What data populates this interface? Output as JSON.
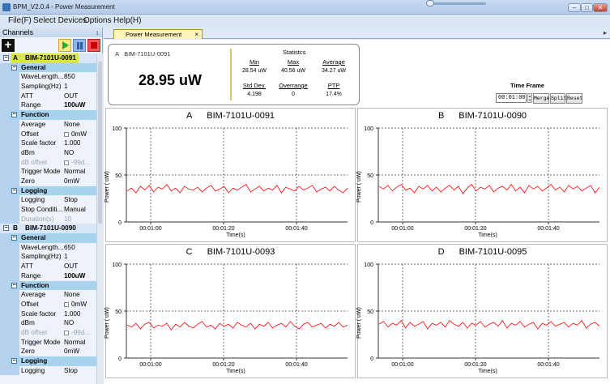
{
  "window": {
    "title": "BPM_V2.0.4 - Power Measurement",
    "minimize_glyph": "–",
    "restore_glyph": "□",
    "close_glyph": "✕"
  },
  "menu": {
    "items": [
      "File(F)",
      "Select Devices",
      "Options",
      "Help(H)"
    ]
  },
  "channels_panel": {
    "title": "Channels",
    "pin_glyph": "↕",
    "devices": [
      {
        "letter": "A",
        "name": "BIM-7101U-0091",
        "selected": true,
        "groups": [
          {
            "name": "General",
            "props": [
              {
                "key": "WaveLength...",
                "value": "850"
              },
              {
                "key": "Sampling(Hz)",
                "value": "1"
              },
              {
                "key": "ATT",
                "value": "OUT"
              },
              {
                "key": "Range",
                "value": "100uW",
                "bold": true
              }
            ]
          },
          {
            "name": "Function",
            "props": [
              {
                "key": "Average",
                "value": "None"
              },
              {
                "key": "Offset",
                "value": "0mW",
                "check": true
              },
              {
                "key": "Scale factor",
                "value": "1.000"
              },
              {
                "key": "dBm",
                "value": "NO"
              },
              {
                "key": "dB offset",
                "value": "-99d...",
                "check": true,
                "disabled": true
              },
              {
                "key": "Trigger Mode",
                "value": "Normal"
              },
              {
                "key": "Zero",
                "value": "0mW"
              }
            ]
          },
          {
            "name": "Logging",
            "props": [
              {
                "key": "Logging",
                "value": "Stop"
              },
              {
                "key": "Stop Conditi...",
                "value": "Manual"
              },
              {
                "key": "Duration(s)",
                "value": "10",
                "disabled": true
              }
            ]
          }
        ]
      },
      {
        "letter": "B",
        "name": "BIM-7101U-0090",
        "selected": false,
        "groups": [
          {
            "name": "General",
            "props": [
              {
                "key": "WaveLength...",
                "value": "650"
              },
              {
                "key": "Sampling(Hz)",
                "value": "1"
              },
              {
                "key": "ATT",
                "value": "OUT"
              },
              {
                "key": "Range",
                "value": "100uW",
                "bold": true
              }
            ]
          },
          {
            "name": "Function",
            "props": [
              {
                "key": "Average",
                "value": "None"
              },
              {
                "key": "Offset",
                "value": "0mW",
                "check": true
              },
              {
                "key": "Scale factor",
                "value": "1.000"
              },
              {
                "key": "dBm",
                "value": "NO"
              },
              {
                "key": "dB offset",
                "value": "-99d...",
                "check": true,
                "disabled": true
              },
              {
                "key": "Trigger Mode",
                "value": "Normal"
              },
              {
                "key": "Zero",
                "value": "0mW"
              }
            ]
          },
          {
            "name": "Logging",
            "props": [
              {
                "key": "Logging",
                "value": "Stop"
              }
            ]
          }
        ]
      }
    ]
  },
  "tab": {
    "label": "Power Measurement",
    "close_glyph": "×",
    "scroll_glyph": "▸"
  },
  "summary": {
    "channel_letter": "A",
    "channel_name": "BIM-7101U-0091",
    "value": "28.95 uW",
    "stats_title": "Statistcs",
    "stats": [
      {
        "label": "Min",
        "value": "28.54 uW"
      },
      {
        "label": "Max",
        "value": "40.56 uW"
      },
      {
        "label": "Average",
        "value": "34.27 uW"
      },
      {
        "label": "Std Dev.",
        "value": "4.198"
      },
      {
        "label": "Overrange",
        "value": "0"
      },
      {
        "label": "PTP",
        "value": "17.4%"
      }
    ]
  },
  "time_frame": {
    "label": "Time Frame",
    "value": "00:01:00",
    "spin_up": "▲",
    "spin_down": "▼",
    "buttons": [
      "Merge",
      "Split",
      "Reset"
    ]
  },
  "chart_data": [
    {
      "type": "line",
      "title_letter": "A",
      "title": "BIM-7101U-0091",
      "xlabel": "Time(s)",
      "ylabel": "Power ( uW)",
      "ylim": [
        0,
        100
      ],
      "yticks": [
        "0",
        "50",
        "100"
      ],
      "xticks": [
        "00:01:00",
        "00:01:20",
        "00:01:40"
      ],
      "grid": true,
      "series": [
        {
          "color": "#ff0000",
          "values": [
            33,
            36,
            31,
            38,
            34,
            39,
            32,
            37,
            35,
            40,
            33,
            36,
            31,
            38,
            35,
            34,
            37,
            32,
            36,
            39,
            33,
            35,
            38,
            31,
            36,
            34,
            37,
            40,
            32,
            35,
            38,
            33,
            36,
            34,
            39,
            31,
            37,
            35,
            33,
            38,
            34,
            36,
            39,
            32,
            35,
            37,
            33,
            38,
            34,
            31,
            36
          ]
        }
      ]
    },
    {
      "type": "line",
      "title_letter": "B",
      "title": "BIM-7101U-0090",
      "xlabel": "Time(s)",
      "ylabel": "Power ( uW)",
      "ylim": [
        0,
        100
      ],
      "yticks": [
        "0",
        "50",
        "100"
      ],
      "xticks": [
        "00:01:00",
        "00:01:20",
        "00:01:40"
      ],
      "grid": true,
      "series": [
        {
          "color": "#ff0000",
          "values": [
            38,
            35,
            39,
            33,
            37,
            40,
            34,
            36,
            31,
            38,
            35,
            39,
            33,
            37,
            32,
            36,
            39,
            34,
            38,
            30,
            36,
            40,
            33,
            37,
            35,
            39,
            32,
            36,
            38,
            34,
            40,
            33,
            37,
            31,
            39,
            35,
            38,
            33,
            36,
            40,
            34,
            37,
            32,
            39,
            35,
            38,
            33,
            36,
            39,
            31,
            37
          ]
        }
      ]
    },
    {
      "type": "line",
      "title_letter": "C",
      "title": "BIM-7101U-0093",
      "xlabel": "Time(s)",
      "ylabel": "Power ( uW)",
      "ylim": [
        0,
        100
      ],
      "yticks": [
        "0",
        "50",
        "100"
      ],
      "xticks": [
        "00:01:00",
        "00:01:20",
        "00:01:40"
      ],
      "grid": true,
      "series": [
        {
          "color": "#ff0000",
          "values": [
            35,
            33,
            37,
            31,
            36,
            38,
            32,
            35,
            34,
            37,
            30,
            36,
            33,
            38,
            34,
            32,
            36,
            39,
            33,
            35,
            31,
            37,
            34,
            36,
            32,
            38,
            35,
            33,
            37,
            31,
            36,
            34,
            38,
            32,
            35,
            37,
            33,
            39,
            34,
            31,
            36,
            38,
            33,
            35,
            37,
            32,
            36,
            34,
            38,
            33,
            35
          ]
        }
      ]
    },
    {
      "type": "line",
      "title_letter": "D",
      "title": "BIM-7101U-0095",
      "xlabel": "Time(s)",
      "ylabel": "Power ( uW)",
      "ylim": [
        0,
        100
      ],
      "yticks": [
        "0",
        "50",
        "100"
      ],
      "xticks": [
        "00:01:00",
        "00:01:20",
        "00:01:40"
      ],
      "grid": true,
      "series": [
        {
          "color": "#ff0000",
          "values": [
            36,
            39,
            33,
            37,
            35,
            40,
            32,
            38,
            34,
            36,
            39,
            31,
            37,
            35,
            38,
            33,
            40,
            36,
            34,
            38,
            32,
            37,
            35,
            39,
            33,
            36,
            38,
            34,
            40,
            32,
            37,
            35,
            39,
            33,
            36,
            38,
            31,
            37,
            35,
            39,
            34,
            36,
            38,
            33,
            37,
            35,
            40,
            32,
            36,
            38,
            34
          ]
        }
      ]
    }
  ]
}
